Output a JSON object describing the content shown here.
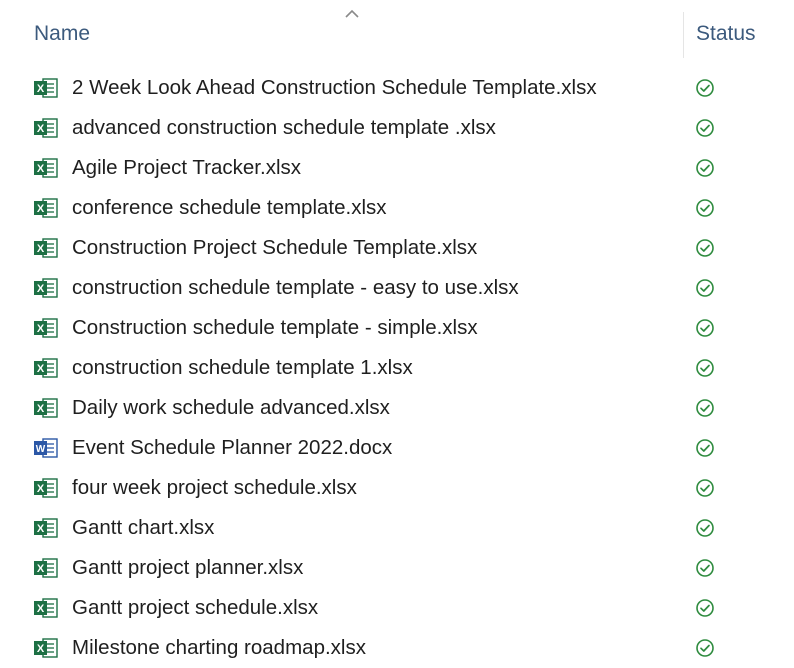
{
  "columns": {
    "name_label": "Name",
    "status_label": "Status",
    "sort_icon": "chevron-up-icon"
  },
  "status_color": "#2e8b3e",
  "files": [
    {
      "name": "2 Week Look Ahead Construction Schedule Template.xlsx",
      "type": "excel",
      "status": "available"
    },
    {
      "name": "advanced construction schedule template .xlsx",
      "type": "excel",
      "status": "available"
    },
    {
      "name": "Agile Project Tracker.xlsx",
      "type": "excel",
      "status": "available"
    },
    {
      "name": "conference schedule template.xlsx",
      "type": "excel",
      "status": "available"
    },
    {
      "name": "Construction Project Schedule Template.xlsx",
      "type": "excel",
      "status": "available"
    },
    {
      "name": "construction schedule template - easy to use.xlsx",
      "type": "excel",
      "status": "available"
    },
    {
      "name": "Construction schedule template - simple.xlsx",
      "type": "excel",
      "status": "available"
    },
    {
      "name": "construction schedule template 1.xlsx",
      "type": "excel",
      "status": "available"
    },
    {
      "name": "Daily work schedule advanced.xlsx",
      "type": "excel",
      "status": "available"
    },
    {
      "name": "Event Schedule Planner 2022.docx",
      "type": "word",
      "status": "available"
    },
    {
      "name": "four week project schedule.xlsx",
      "type": "excel",
      "status": "available"
    },
    {
      "name": "Gantt chart.xlsx",
      "type": "excel",
      "status": "available"
    },
    {
      "name": "Gantt project planner.xlsx",
      "type": "excel",
      "status": "available"
    },
    {
      "name": "Gantt project schedule.xlsx",
      "type": "excel",
      "status": "available"
    },
    {
      "name": "Milestone charting roadmap.xlsx",
      "type": "excel",
      "status": "available"
    }
  ]
}
